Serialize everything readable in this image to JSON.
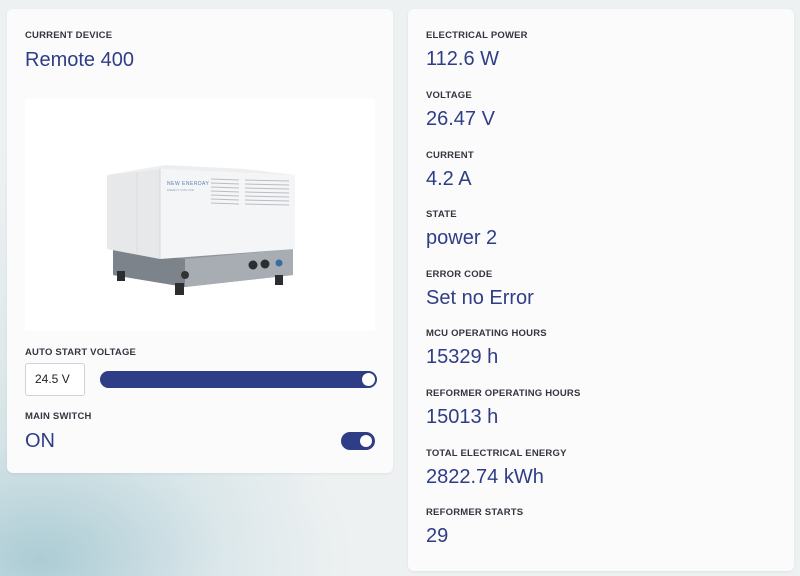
{
  "device": {
    "label": "CURRENT DEVICE",
    "name": "Remote 400",
    "image_brand_text": "NEW ENERDAY",
    "image_subtext": "ENERGY FOR LIFE"
  },
  "auto_start": {
    "label": "AUTO START VOLTAGE",
    "value": "24.5 V",
    "slider_level": 1.0
  },
  "main_switch": {
    "label": "MAIN SWITCH",
    "value": "ON",
    "on": true
  },
  "stats": [
    {
      "label": "ELECTRICAL POWER",
      "value": "112.6 W"
    },
    {
      "label": "VOLTAGE",
      "value": "26.47 V"
    },
    {
      "label": "CURRENT",
      "value": "4.2 A"
    },
    {
      "label": "STATE",
      "value": "power 2"
    },
    {
      "label": "ERROR CODE",
      "value": "Set no Error"
    },
    {
      "label": "MCU OPERATING HOURS",
      "value": "15329 h"
    },
    {
      "label": "REFORMER OPERATING HOURS",
      "value": "15013 h"
    },
    {
      "label": "TOTAL ELECTRICAL ENERGY",
      "value": "2822.74 kWh"
    },
    {
      "label": "REFORMER STARTS",
      "value": "29"
    }
  ],
  "colors": {
    "accent": "#2f3d86",
    "label_text": "#333640",
    "card_bg": "#fbfbfc",
    "page_bg": "#eef1f2"
  }
}
